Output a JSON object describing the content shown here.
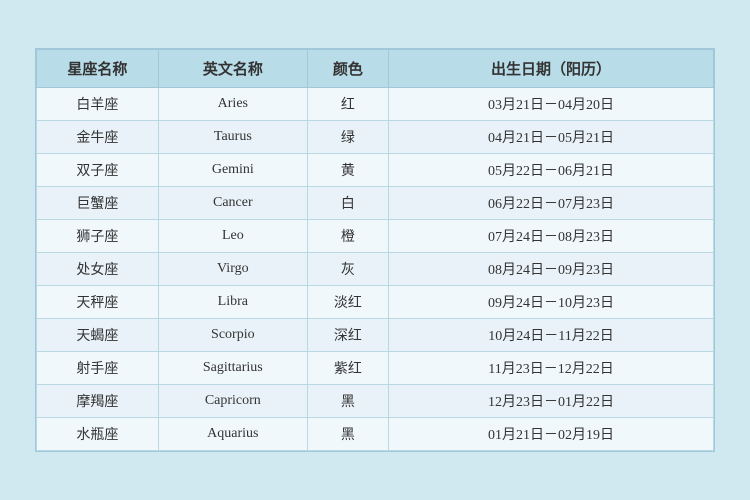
{
  "table": {
    "headers": {
      "chinese_name": "星座名称",
      "english_name": "英文名称",
      "color": "颜色",
      "date": "出生日期（阳历）"
    },
    "rows": [
      {
        "chinese": "白羊座",
        "english": "Aries",
        "color": "红",
        "date": "03月21日－04月20日"
      },
      {
        "chinese": "金牛座",
        "english": "Taurus",
        "color": "绿",
        "date": "04月21日－05月21日"
      },
      {
        "chinese": "双子座",
        "english": "Gemini",
        "color": "黄",
        "date": "05月22日－06月21日"
      },
      {
        "chinese": "巨蟹座",
        "english": "Cancer",
        "color": "白",
        "date": "06月22日－07月23日"
      },
      {
        "chinese": "狮子座",
        "english": "Leo",
        "color": "橙",
        "date": "07月24日－08月23日"
      },
      {
        "chinese": "处女座",
        "english": "Virgo",
        "color": "灰",
        "date": "08月24日－09月23日"
      },
      {
        "chinese": "天秤座",
        "english": "Libra",
        "color": "淡红",
        "date": "09月24日－10月23日"
      },
      {
        "chinese": "天蝎座",
        "english": "Scorpio",
        "color": "深红",
        "date": "10月24日－11月22日"
      },
      {
        "chinese": "射手座",
        "english": "Sagittarius",
        "color": "紫红",
        "date": "11月23日－12月22日"
      },
      {
        "chinese": "摩羯座",
        "english": "Capricorn",
        "color": "黑",
        "date": "12月23日－01月22日"
      },
      {
        "chinese": "水瓶座",
        "english": "Aquarius",
        "color": "黑",
        "date": "01月21日－02月19日"
      }
    ]
  }
}
